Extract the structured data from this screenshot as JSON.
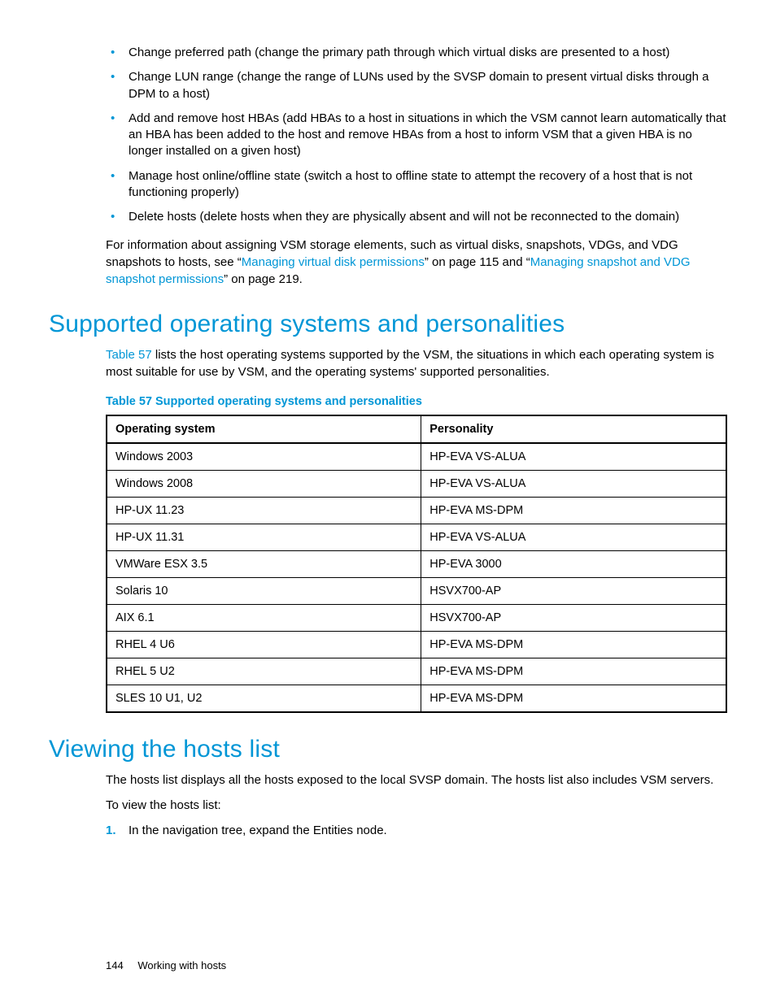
{
  "bullets": [
    "Change preferred path (change the primary path through which virtual disks are presented to a host)",
    "Change LUN range (change the range of LUNs used by the SVSP domain to present virtual disks through a DPM to a host)",
    "Add and remove host HBAs (add HBAs to a host in situations in which the VSM cannot learn automatically that an HBA has been added to the host and remove HBAs from a host to inform VSM that a given HBA is no longer installed on a given host)",
    "Manage host online/offline state (switch a host to offline state to attempt the recovery of a host that is not functioning properly)",
    "Delete hosts (delete hosts when they are physically absent and will not be reconnected to the domain)"
  ],
  "para_info": {
    "pre": "For information about assigning VSM storage elements, such as virtual disks, snapshots, VDGs, and VDG snapshots to hosts, see “",
    "link1": "Managing virtual disk permissions",
    "mid1": "” on page 115 and “",
    "link2": "Managing snapshot and VDG snapshot permissions",
    "post": "” on page 219."
  },
  "section1": {
    "title": "Supported operating systems and personalities",
    "intro_pre": "",
    "intro_link": "Table 57",
    "intro_post": " lists the host operating systems supported by the VSM, the situations in which each operating system is most suitable for use by VSM, and the operating systems' supported personalities.",
    "table_caption": "Table 57 Supported operating systems and personalities",
    "table": {
      "headers": [
        "Operating system",
        "Personality"
      ],
      "rows": [
        [
          "Windows 2003",
          "HP-EVA VS-ALUA"
        ],
        [
          "Windows 2008",
          "HP-EVA VS-ALUA"
        ],
        [
          "HP-UX 11.23",
          "HP-EVA MS-DPM"
        ],
        [
          "HP-UX 11.31",
          "HP-EVA VS-ALUA"
        ],
        [
          "VMWare ESX 3.5",
          "HP-EVA 3000"
        ],
        [
          "Solaris 10",
          "HSVX700-AP"
        ],
        [
          "AIX 6.1",
          "HSVX700-AP"
        ],
        [
          "RHEL 4 U6",
          "HP-EVA MS-DPM"
        ],
        [
          "RHEL 5 U2",
          "HP-EVA MS-DPM"
        ],
        [
          "SLES 10 U1, U2",
          "HP-EVA MS-DPM"
        ]
      ]
    }
  },
  "section2": {
    "title": "Viewing the hosts list",
    "p1": "The hosts list displays all the hosts exposed to the local SVSP domain. The hosts list also includes VSM servers.",
    "p2": "To view the hosts list:",
    "steps": [
      "In the navigation tree, expand the Entities node."
    ]
  },
  "footer": {
    "page": "144",
    "label": "Working with hosts"
  }
}
